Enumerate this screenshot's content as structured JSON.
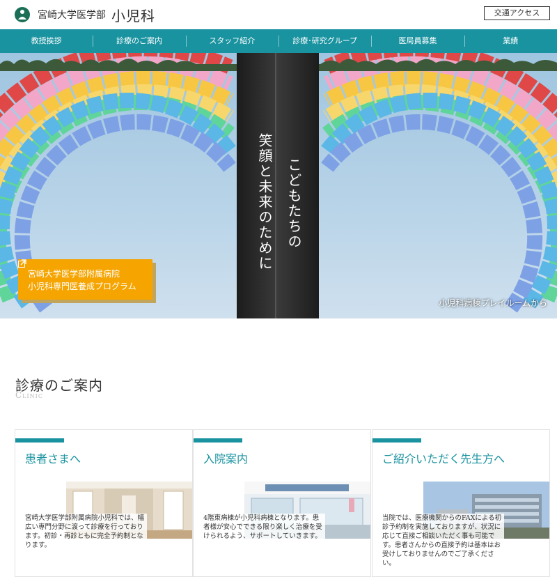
{
  "header": {
    "name_small": "宮崎大学医学部",
    "name_big": "小児科",
    "access_button": "交通アクセス"
  },
  "nav": [
    "教授挨拶",
    "診療のご案内",
    "スタッフ紹介",
    "診療･研究グループ",
    "医局員募集",
    "業績"
  ],
  "hero": {
    "tagline_1": "こどもたちの",
    "tagline_2": "笑顔と未来のために",
    "program_line1": "宮崎大学医学部附属病院",
    "program_line2": "小児科専門医養成プログラム",
    "caption": "小児科病棟プレイルームから"
  },
  "clinic": {
    "title": "診療のご案内",
    "subtitle": "Clinic",
    "cards": [
      {
        "title": "患者さまへ",
        "text": "宮崎大学医学部附属病院小児科では、幅広い専門分野に渡って診療を行っております。初診・再診ともに完全予約制となります。"
      },
      {
        "title": "入院案内",
        "text": "4階東病棟が小児科病棟となります。患者様が安心でできる限り楽しく治療を受けられるよう、サポートしていきます。"
      },
      {
        "title": "ご紹介いただく先生方へ",
        "text": "当院では、医療機関からのFAXによる初診予約制を実施しておりますが、状況に応じて直接ご相談いただく事も可能です。患者さんからの直接予約は基本はお受けしておりませんのでご了承ください。"
      }
    ]
  },
  "colors": {
    "accent": "#1a93a0",
    "program": "#f5a400"
  }
}
